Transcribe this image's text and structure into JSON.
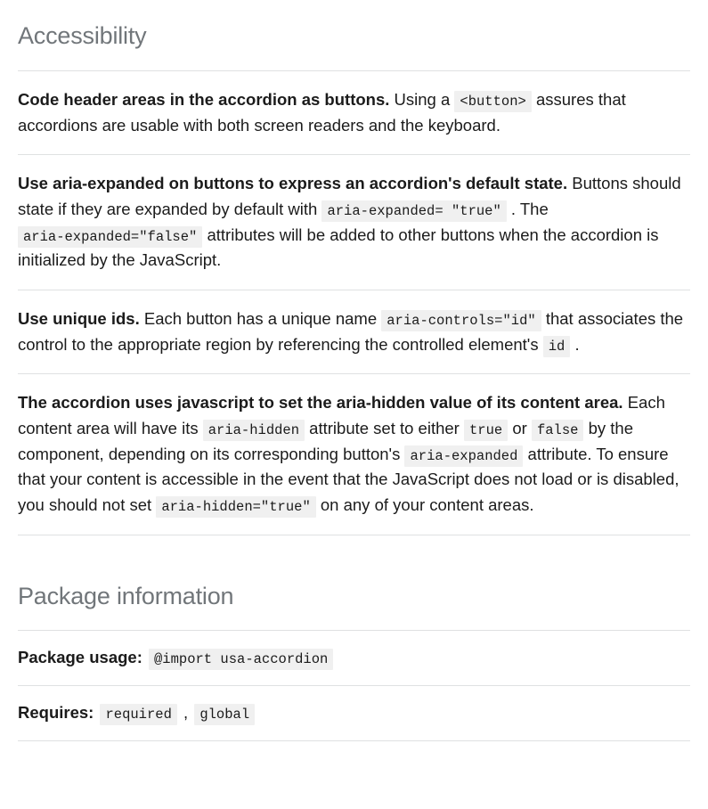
{
  "accessibility": {
    "heading": "Accessibility",
    "items": [
      {
        "bold": "Code header areas in the accordion as buttons.",
        "t1": " Using a ",
        "c1": "<button>",
        "t2": " assures that accordions are usable with both screen readers and the keyboard."
      },
      {
        "bold": "Use aria-expanded on buttons to express an accordion's default state.",
        "t1": " Buttons should state if they are expanded by default with ",
        "c1": "aria-expanded= \"true\"",
        "t2": " . The ",
        "c2": "aria-expanded=\"false\"",
        "t3": " attributes will be added to other buttons when the accordion is initialized by the JavaScript."
      },
      {
        "bold": "Use unique ids.",
        "t1": " Each button has a unique name ",
        "c1": "aria-controls=\"id\"",
        "t2": " that associates the control to the appropriate region by referencing the controlled element's ",
        "c2": "id",
        "t3": " ."
      },
      {
        "bold": "The accordion uses javascript to set the aria-hidden value of its content area.",
        "t1": " Each content area will have its ",
        "c1": "aria-hidden",
        "t2": " attribute set to either ",
        "c2": "true",
        "t3": " or ",
        "c3": "false",
        "t4": " by the component, depending on its corresponding button's ",
        "c4": "aria-expanded",
        "t5": " attribute. To ensure that your content is accessible in the event that the JavaScript does not load or is disabled, you should not set ",
        "c5": "aria-hidden=\"true\"",
        "t6": " on any of your content areas."
      }
    ]
  },
  "package": {
    "heading": "Package information",
    "usage": {
      "label": "Package usage:",
      "code": "@import usa-accordion"
    },
    "requires": {
      "label": "Requires:",
      "code1": "required",
      "sep": " , ",
      "code2": "global"
    }
  }
}
